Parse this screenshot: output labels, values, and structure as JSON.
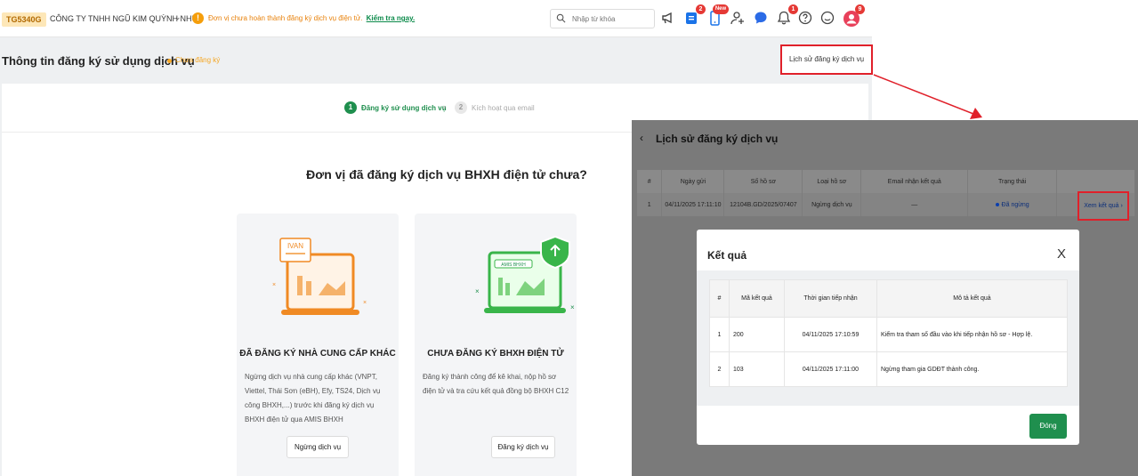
{
  "topbar": {
    "tax_code": "TG5340G",
    "company": "CÔNG TY TNHH NGŨ KIM QUỲNH NHƯ",
    "warning_text": "Đơn vị chưa hoàn thành đăng ký dịch vụ điện tử.",
    "warning_link": "Kiểm tra ngay.",
    "search_placeholder": "Nhập từ khóa",
    "icons": [
      "megaphone-icon",
      "clipboard-icon",
      "phone-icon",
      "add-user-icon",
      "chat-icon",
      "bell-icon",
      "help-icon",
      "emoji-icon",
      "avatar"
    ],
    "badges": {
      "clipboard": "2",
      "phone": "New",
      "bell": "1",
      "avatar": "9"
    }
  },
  "page": {
    "title": "Thông tin đăng ký sử dụng dịch vụ",
    "status": "Chưa đăng ký",
    "history_button": "Lịch sử đăng ký dịch vụ"
  },
  "stepper": {
    "steps": [
      {
        "num": "1",
        "label": "Đăng ký sử dụng dịch vụ"
      },
      {
        "num": "2",
        "label": "Kích hoạt qua email"
      }
    ],
    "separator": "›"
  },
  "main": {
    "question": "Đơn vị đã đăng ký dịch vụ BHXH điện tử chưa?",
    "options": [
      {
        "badge": "IVAN",
        "title": "ĐÃ ĐĂNG KÝ NHÀ CUNG CẤP KHÁC",
        "desc": "Ngừng dịch vụ nhà cung cấp khác (VNPT, Viettel, Thái Sơn (eBH), Efy, TS24, Dịch vụ công BHXH,...) trước khi đăng ký dịch vụ BHXH điện tử qua AMIS BHXH",
        "button": "Ngừng dịch vụ"
      },
      {
        "badge": "AMIS BHXH",
        "title": "CHƯA ĐĂNG KÝ BHXH ĐIỆN TỬ",
        "desc": "Đăng ký thành công để kê khai, nộp hồ sơ điện tử và tra cứu kết quả đồng bộ BHXH C12",
        "button": "Đăng ký dịch vụ"
      }
    ]
  },
  "history": {
    "title": "Lịch sử đăng ký dịch vụ",
    "columns": [
      "#",
      "Ngày gửi",
      "Số hồ sơ",
      "Loại hồ sơ",
      "Email nhận kết quả",
      "Trạng thái",
      ""
    ],
    "rows": [
      {
        "idx": "1",
        "date": "04/11/2025 17:11:10",
        "code": "12104B.GD/2025/07407",
        "type": "Ngừng dịch vụ",
        "email": "—",
        "status": "Đã ngừng",
        "action": "Xem kết quả"
      }
    ]
  },
  "result_modal": {
    "title": "Kết quả",
    "close_x": "X",
    "columns": [
      "#",
      "Mã kết quả",
      "Thời gian tiếp nhận",
      "Mô tả kết quả"
    ],
    "rows": [
      {
        "idx": "1",
        "code": "200",
        "time": "04/11/2025 17:10:59",
        "desc": "Kiểm tra tham số đầu vào khi tiếp nhận hồ sơ - Hợp lệ."
      },
      {
        "idx": "2",
        "code": "103",
        "time": "04/11/2025 17:11:00",
        "desc": "Ngừng tham gia GDĐT thành công."
      }
    ],
    "close_button": "Đóng"
  },
  "colors": {
    "accent_green": "#1f8f4e",
    "warning_orange": "#f59e0b",
    "highlight_red": "#e0202a",
    "badge_red": "#e53935"
  }
}
